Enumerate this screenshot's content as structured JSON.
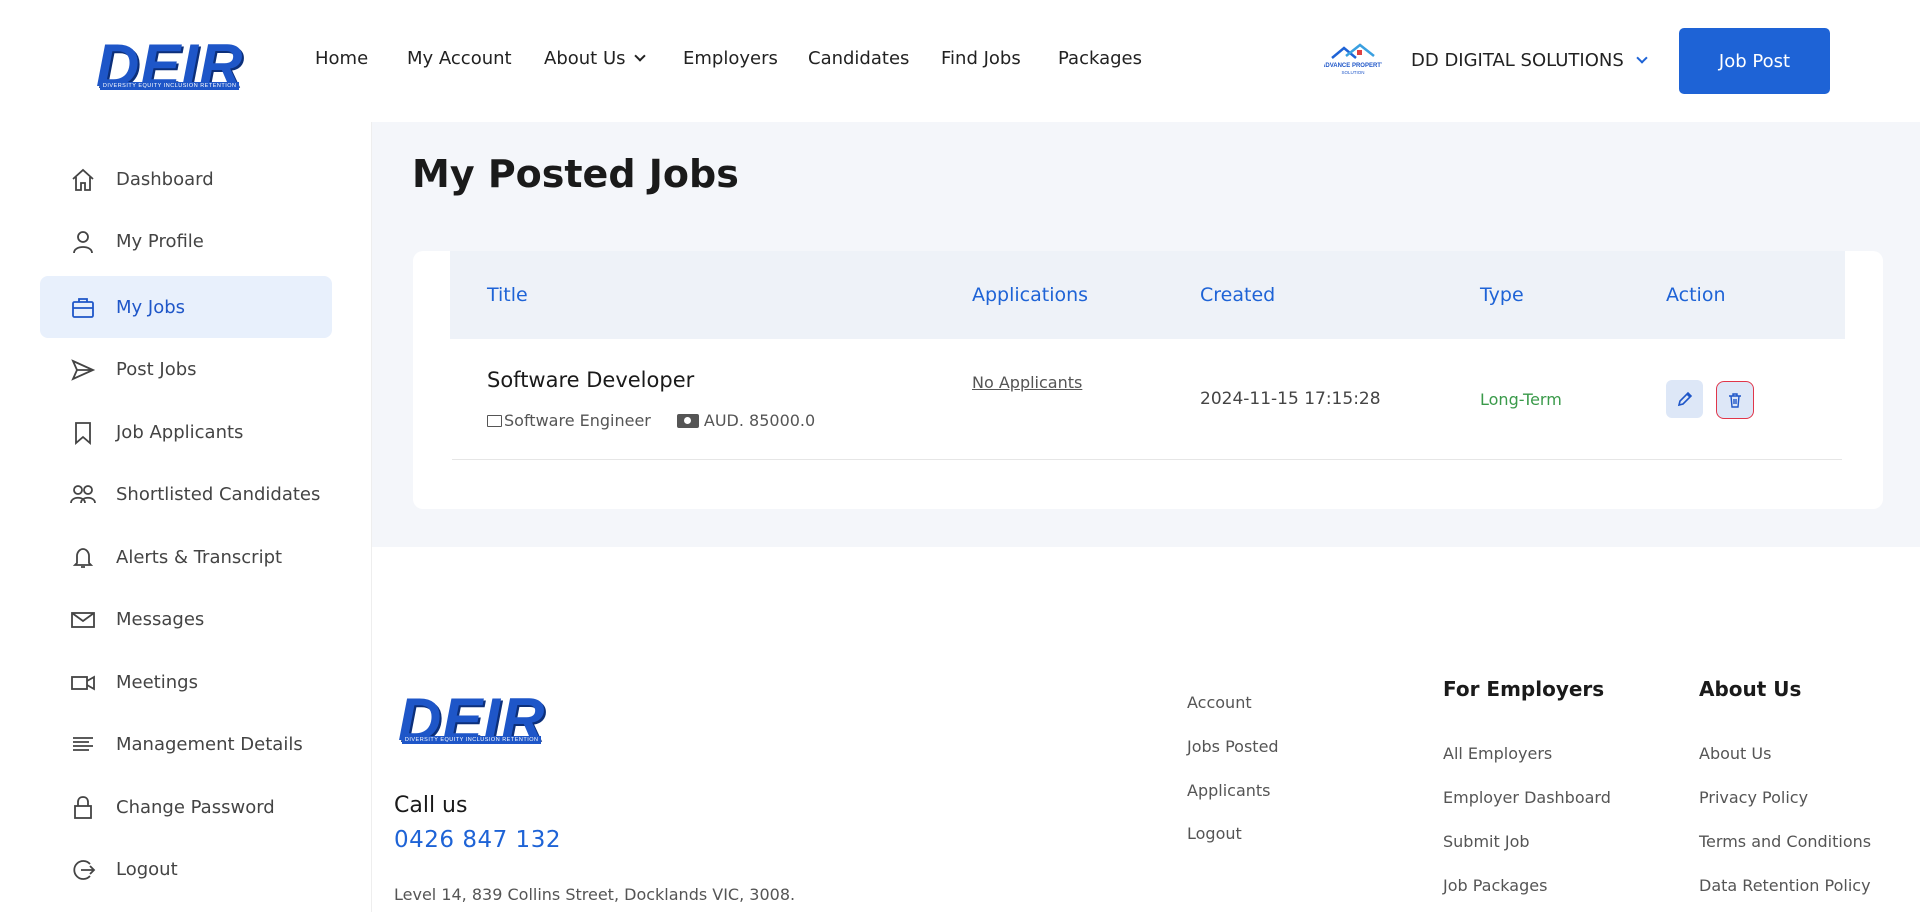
{
  "brand": {
    "logo_text": "DEIR",
    "logo_tagline": "DIVERSITY EQUITY INCLUSION RETENTION"
  },
  "nav": {
    "items": [
      "Home",
      "My Account",
      "About Us",
      "Employers",
      "Candidates",
      "Find Jobs",
      "Packages"
    ]
  },
  "account": {
    "company_logo_text": "ADVANCE PROPERTY SOLUTION",
    "company_name": "DD DIGITAL SOLUTIONS",
    "job_post_label": "Job Post"
  },
  "sidebar": {
    "items": [
      {
        "label": "Dashboard",
        "icon": "home-icon"
      },
      {
        "label": "My Profile",
        "icon": "user-icon"
      },
      {
        "label": "My Jobs",
        "icon": "briefcase-icon",
        "active": true
      },
      {
        "label": "Post Jobs",
        "icon": "send-icon"
      },
      {
        "label": "Job Applicants",
        "icon": "bookmark-icon"
      },
      {
        "label": "Shortlisted Candidates",
        "icon": "users-icon"
      },
      {
        "label": "Alerts & Transcript",
        "icon": "bell-icon"
      },
      {
        "label": "Messages",
        "icon": "mail-icon"
      },
      {
        "label": "Meetings",
        "icon": "video-icon"
      },
      {
        "label": "Management Details",
        "icon": "list-icon"
      },
      {
        "label": "Change Password",
        "icon": "lock-icon"
      },
      {
        "label": "Logout",
        "icon": "logout-icon"
      }
    ]
  },
  "main": {
    "title": "My Posted Jobs",
    "table": {
      "headers": [
        "Title",
        "Applications",
        "Created",
        "Type",
        "Action"
      ],
      "rows": [
        {
          "title": "Software Developer",
          "category": "Software Engineer",
          "salary": "AUD. 85000.0",
          "applications": "No Applicants",
          "created": "2024-11-15 17:15:28",
          "type": "Long-Term"
        }
      ]
    }
  },
  "footer": {
    "call_us_label": "Call us",
    "phone": "0426 847 132",
    "address": "Level 14, 839 Collins Street, Docklands VIC, 3008.",
    "account_links": [
      "Account",
      "Jobs Posted",
      "Applicants",
      "Logout"
    ],
    "employers_heading": "For Employers",
    "employers_links": [
      "All Employers",
      "Employer Dashboard",
      "Submit Job",
      "Job Packages"
    ],
    "about_heading": "About Us",
    "about_links": [
      "About Us",
      "Privacy Policy",
      "Terms and Conditions",
      "Data Retention Policy"
    ]
  },
  "colors": {
    "accent": "#1e63d6",
    "type_green": "#3a9a4a",
    "delete_red": "#e0364a",
    "main_bg": "#f4f6fa"
  }
}
